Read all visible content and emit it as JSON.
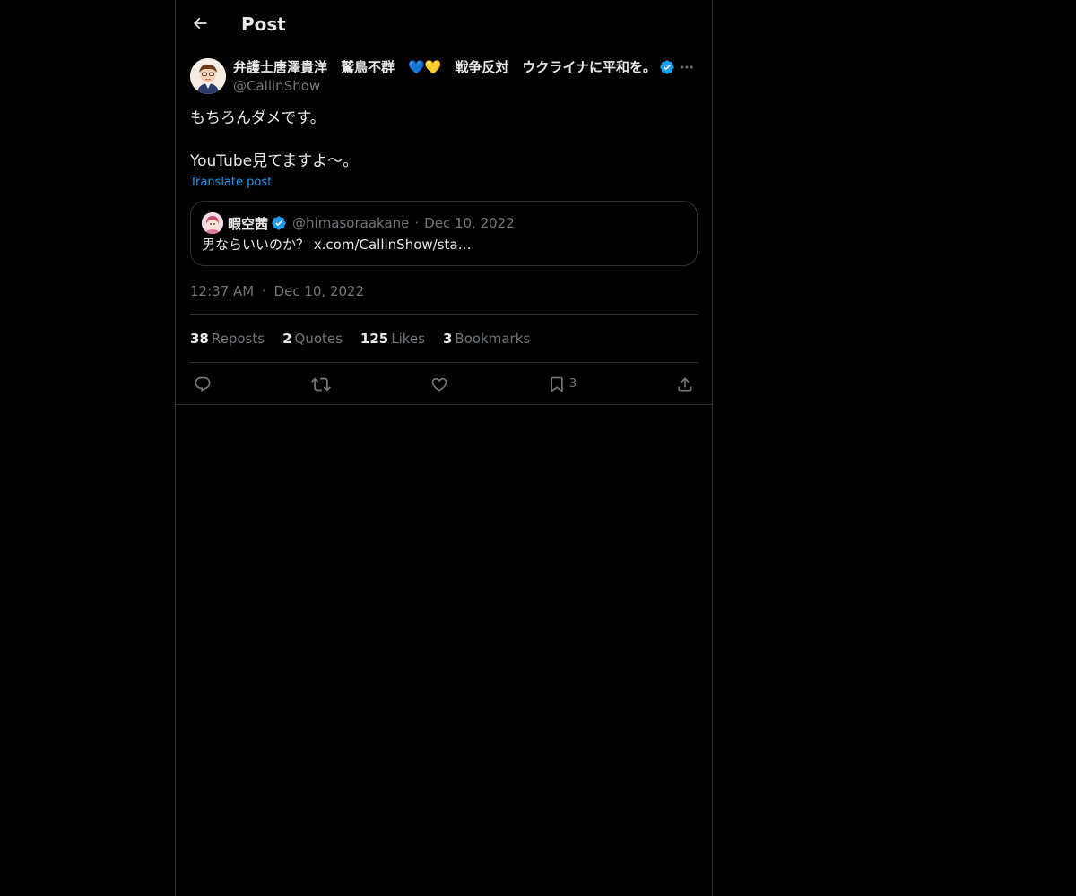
{
  "header": {
    "title": "Post",
    "back_icon": "arrow-left-icon"
  },
  "post": {
    "author": {
      "display_name": "弁護士唐澤貴洋　鷲鳥不群　💙💛　戦争反対　ウクライナに平和を。",
      "handle": "@CallinShow",
      "verified": true
    },
    "body_lines": [
      "もちろんダメです。",
      "YouTube見てますよ〜。"
    ],
    "translate_label": "Translate post",
    "quote": {
      "display_name": "暇空茜",
      "handle": "@himasoraakane",
      "separator": "·",
      "date": "Dec 10, 2022",
      "text": "男ならいいのか？ x.com/CallinShow/sta…",
      "verified": true
    },
    "time": "12:37 AM",
    "time_separator": "·",
    "date": "Dec 10, 2022",
    "stats": {
      "reposts_count": "38",
      "reposts_label": "Reposts",
      "quotes_count": "2",
      "quotes_label": "Quotes",
      "likes_count": "125",
      "likes_label": "Likes",
      "bookmarks_count": "3",
      "bookmarks_label": "Bookmarks"
    },
    "actions": {
      "bookmark_count": "3"
    }
  },
  "colors": {
    "background": "#000000",
    "text_primary": "#e7e9ea",
    "text_secondary": "#71767b",
    "accent": "#1d9bf0",
    "border": "#2f3336"
  }
}
